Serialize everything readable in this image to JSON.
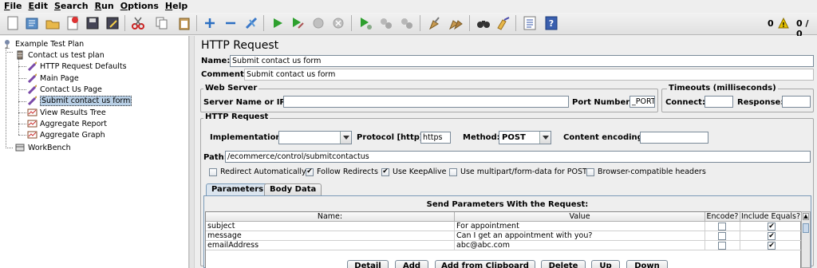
{
  "menubar": {
    "items": [
      "File",
      "Edit",
      "Search",
      "Run",
      "Options",
      "Help"
    ]
  },
  "toolbar": {
    "icons": [
      "new-icon",
      "templates-icon",
      "open-icon",
      "close-icon",
      "save-icon",
      "save-as-icon",
      "cut-icon",
      "copy-icon",
      "paste-icon",
      "expand-icon",
      "collapse-icon",
      "toggle-icon",
      "start-icon",
      "start-no-pause-icon",
      "stop-icon",
      "shutdown-icon",
      "remote-start-icon",
      "remote-stop-icon",
      "remote-exit-icon",
      "clear-icon",
      "clear-all-icon",
      "search-icon",
      "reset-search-icon",
      "function-helper-icon",
      "help-icon"
    ],
    "status_count": "0",
    "status_threads": "0 / 0",
    "warning_color": "#e6c200"
  },
  "tree": {
    "nodes": [
      {
        "label": "Example Test Plan",
        "icon": "test-plan-icon"
      },
      {
        "label": "Contact us test plan",
        "icon": "thread-group-icon"
      },
      {
        "label": "HTTP Request Defaults",
        "icon": "config-icon"
      },
      {
        "label": "Main Page",
        "icon": "sampler-icon"
      },
      {
        "label": "Contact Us Page",
        "icon": "sampler-icon"
      },
      {
        "label": "Submit contact us form",
        "icon": "sampler-icon"
      },
      {
        "label": "View Results Tree",
        "icon": "listener-icon"
      },
      {
        "label": "Aggregate Report",
        "icon": "listener-icon"
      },
      {
        "label": "Aggregate Graph",
        "icon": "listener-icon"
      },
      {
        "label": "WorkBench",
        "icon": "workbench-icon"
      }
    ]
  },
  "panel": {
    "title": "HTTP Request",
    "name_label": "Name:",
    "name_value": "Submit contact us form",
    "comments_label": "Comments:",
    "comments_value": "Submit contact us form",
    "web_server": {
      "legend": "Web Server",
      "server_label": "Server Name or IP:",
      "server_value": "",
      "port_label": "Port Number:",
      "port_value": "_PORT}"
    },
    "timeouts": {
      "legend": "Timeouts (milliseconds)",
      "connect_label": "Connect:",
      "connect_value": "",
      "response_label": "Response:",
      "response_value": ""
    },
    "http_request": {
      "legend": "HTTP Request",
      "implementation_label": "Implementation:",
      "implementation_value": "",
      "protocol_label": "Protocol [http]:",
      "protocol_value": "https",
      "method_label": "Method:",
      "method_value": "POST",
      "encoding_label": "Content encoding:",
      "encoding_value": "",
      "path_label": "Path:",
      "path_value": "/ecommerce/control/submitcontactus",
      "checkboxes": [
        {
          "label": "Redirect Automatically",
          "checked": false
        },
        {
          "label": "Follow Redirects",
          "checked": true
        },
        {
          "label": "Use KeepAlive",
          "checked": true
        },
        {
          "label": "Use multipart/form-data for POST",
          "checked": false
        },
        {
          "label": "Browser-compatible headers",
          "checked": false
        }
      ]
    },
    "tabs": [
      "Parameters",
      "Body Data"
    ],
    "params": {
      "caption": "Send Parameters With the Request:",
      "columns": [
        "Name:",
        "Value",
        "Encode?",
        "Include Equals?"
      ],
      "rows": [
        {
          "name": "subject",
          "value": "For appointment",
          "encode": false,
          "equals": true
        },
        {
          "name": "message",
          "value": "Can I get an appointment with you?",
          "encode": false,
          "equals": true
        },
        {
          "name": "emailAddress",
          "value": "abc@abc.com",
          "encode": false,
          "equals": true
        }
      ]
    },
    "buttons": [
      "Detail",
      "Add",
      "Add from Clipboard",
      "Delete",
      "Up",
      "Down"
    ]
  }
}
